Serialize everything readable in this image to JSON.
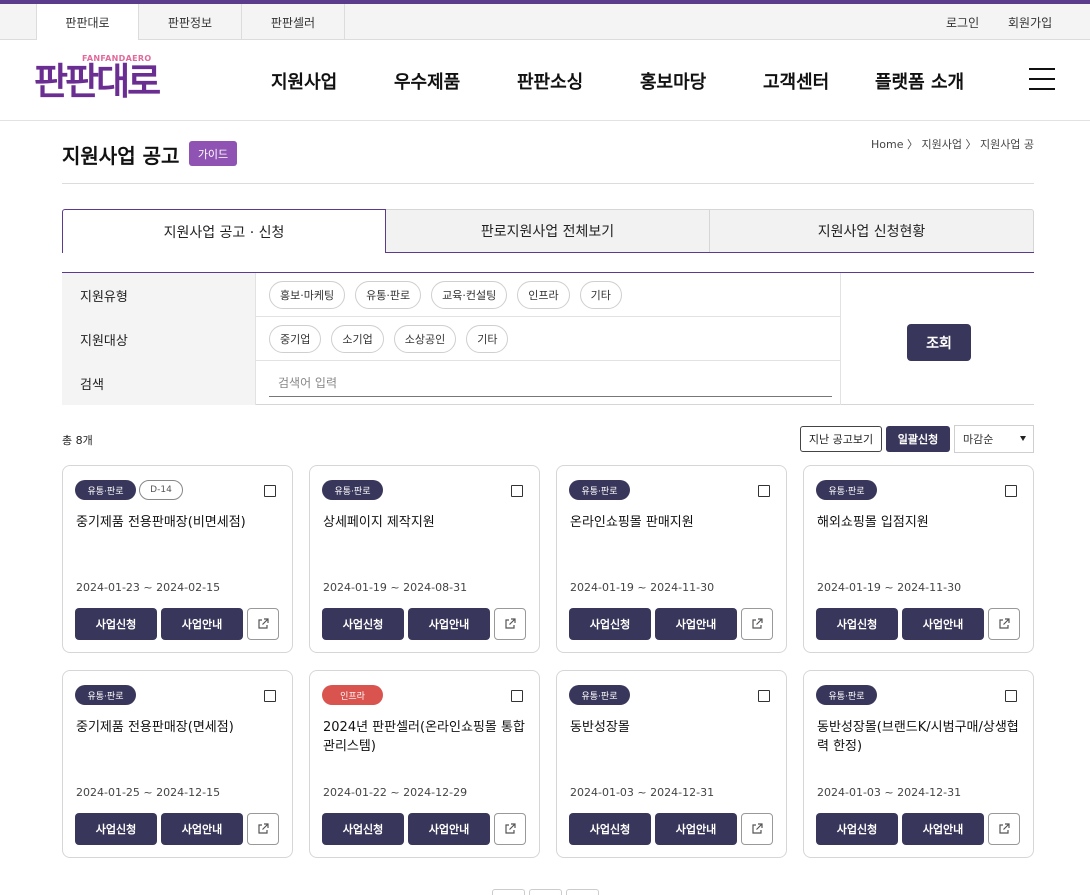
{
  "site_tabs": [
    "판판대로",
    "판판정보",
    "판판셀러"
  ],
  "util": {
    "login": "로그인",
    "join": "회원가입"
  },
  "logo": {
    "sub": "FANFANDAERO",
    "main": "판판대로"
  },
  "gnb": [
    "지원사업",
    "우수제품",
    "판판소싱",
    "홍보마당",
    "고객센터",
    "플랫폼 소개"
  ],
  "page": {
    "title": "지원사업 공고",
    "guide": "가이드",
    "breadcrumb": "Home 〉 지원사업 〉 지원사업 공고"
  },
  "tabs": [
    "지원사업 공고 · 신청",
    "판로지원사업 전체보기",
    "지원사업 신청현황"
  ],
  "filter": {
    "type_label": "지원유형",
    "type_options": [
      "홍보·마케팅",
      "유통·판로",
      "교육·컨설팅",
      "인프라",
      "기타"
    ],
    "target_label": "지원대상",
    "target_options": [
      "중기업",
      "소기업",
      "소상공인",
      "기타"
    ],
    "search_label": "검색",
    "search_placeholder": "검색어 입력",
    "search_button": "조회"
  },
  "list": {
    "total": "총 8개",
    "past_button": "지난 공고보기",
    "bulk_button": "일괄신청",
    "sort_selected": "마감순"
  },
  "card_labels": {
    "apply": "사업신청",
    "info": "사업안내"
  },
  "cards": [
    {
      "category": "유통·판로",
      "dday": "D-14",
      "title": "중기제품 전용판매장(비면세점)",
      "period": "2024-01-23 ~ 2024-02-15"
    },
    {
      "category": "유통·판로",
      "title": "상세페이지 제작지원",
      "period": "2024-01-19 ~ 2024-08-31"
    },
    {
      "category": "유통·판로",
      "title": "온라인쇼핑몰 판매지원",
      "period": "2024-01-19 ~ 2024-11-30"
    },
    {
      "category": "유통·판로",
      "title": "해외쇼핑몰 입점지원",
      "period": "2024-01-19 ~ 2024-11-30"
    },
    {
      "category": "유통·판로",
      "title": "중기제품 전용판매장(면세점)",
      "period": "2024-01-25 ~ 2024-12-15"
    },
    {
      "category": "인프라",
      "category_color": "#d9534f",
      "title": "2024년 판판셀러(온라인쇼핑몰 통합관리스템)",
      "period": "2024-01-22 ~ 2024-12-29"
    },
    {
      "category": "유통·판로",
      "title": "동반성장몰",
      "period": "2024-01-03 ~ 2024-12-31"
    },
    {
      "category": "유통·판로",
      "title": "동반성장몰(브랜드K/시범구매/상생협력 한정)",
      "period": "2024-01-03 ~ 2024-12-31"
    }
  ],
  "colors": {
    "accent": "#5b3b8c",
    "button": "#38365a",
    "guide": "#8e53b3",
    "logo": "#6a2d91"
  },
  "icons": {
    "link": "external-link-icon",
    "menu": "hamburger-menu-icon"
  }
}
